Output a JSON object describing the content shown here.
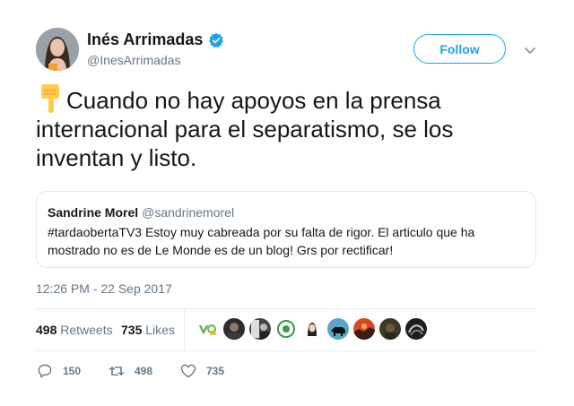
{
  "author": {
    "name": "Inés Arrimadas",
    "handle": "@InesArrimadas"
  },
  "follow_button": {
    "label": "Follow"
  },
  "tweet": {
    "emoji": "backhand-index-pointing-down",
    "text": "Cuando no hay apoyos en la prensa internacional para el separatismo, se los inventan y listo.",
    "timestamp": "12:26 PM - 22 Sep 2017"
  },
  "quoted_tweet": {
    "name": "Sandrine Morel",
    "handle": "@sandrinemorel",
    "text": "#tardaobertaTV3 Estoy muy cabreada por su falta de rigor. El articulo que ha mostrado no es de Le Monde es de un blog! Grs por rectificar!"
  },
  "stats": {
    "retweets_count": "498",
    "retweets_label": "Retweets",
    "likes_count": "735",
    "likes_label": "Likes"
  },
  "actions": {
    "reply_count": "150",
    "retweet_count": "498",
    "like_count": "735"
  },
  "colors": {
    "accent": "#1da1f2",
    "text_primary": "#14171a",
    "text_secondary": "#657786",
    "border": "#e1e8ed"
  }
}
